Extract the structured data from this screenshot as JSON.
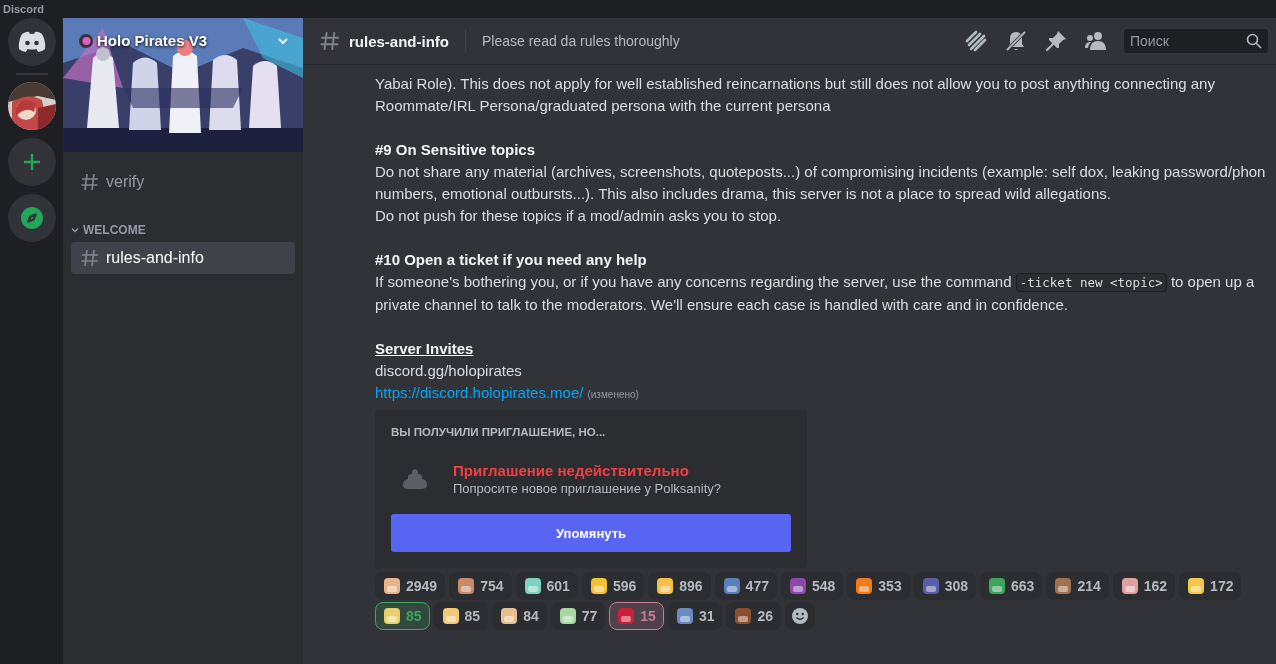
{
  "app_title": "Discord",
  "servers": [
    {
      "kind": "home"
    },
    {
      "kind": "server"
    },
    {
      "kind": "add"
    },
    {
      "kind": "discover"
    }
  ],
  "server": {
    "name": "Holo Pirates V3"
  },
  "channels": [
    {
      "name": "verify",
      "selected": false
    }
  ],
  "categories": [
    {
      "name": "WELCOME",
      "expanded": true,
      "channels": [
        {
          "name": "rules-and-info",
          "selected": true
        }
      ]
    }
  ],
  "header": {
    "channel": "rules-and-info",
    "topic": "Please read da rules thoroughly",
    "search": {
      "placeholder": "Поиск"
    }
  },
  "message": [
    {
      "kind": "text",
      "text": "Yabai Role). This does not apply for well established reincarnations but still does not allow you to post anything connecting any Roommate/IRL Persona/graduated persona with the current persona"
    },
    {
      "kind": "heading",
      "text": "#9 On Sensitive topics"
    },
    {
      "kind": "text",
      "text": "Do not share any material (archives, screenshots, quoteposts...) of compromising incidents (example: self dox, leaking password/phon numbers, emotional outbursts...). This also includes drama, this server is not a place to spread wild allegations."
    },
    {
      "kind": "text",
      "text": "Do not push for these topics if a mod/admin asks you to stop."
    },
    {
      "kind": "heading",
      "text": "#10 Open a ticket if you need any help"
    },
    {
      "kind": "mixed",
      "parts": [
        {
          "kind": "text",
          "text": "If someone's bothering you, or if you have any concerns regarding the server, use the command "
        },
        {
          "kind": "code",
          "text": "-ticket new <topic>"
        },
        {
          "kind": "text",
          "text": " to open up a private channel to talk to the moderators. We'll ensure each case is handled with care and in confidence."
        }
      ]
    },
    {
      "kind": "title",
      "text": "Server Invites"
    },
    {
      "kind": "text",
      "text": "discord.gg/holopirates"
    },
    {
      "kind": "link",
      "text": "https://discord.holopirates.moe/",
      "note": "(изменено)"
    }
  ],
  "invite": {
    "title": "ВЫ ПОЛУЧИЛИ ПРИГЛАШЕНИЕ, НО...",
    "status": "Приглашение недействительно",
    "hint": "Попросите новое приглашение у Polksanity?",
    "button": "Упомянуть"
  },
  "reaction_rows": [
    [
      {
        "count": "2949",
        "selected": false
      },
      {
        "count": "754",
        "selected": false
      },
      {
        "count": "601",
        "selected": false
      },
      {
        "count": "596",
        "selected": false
      },
      {
        "count": "896",
        "selected": false
      },
      {
        "count": "477",
        "selected": false
      },
      {
        "count": "548",
        "selected": false
      },
      {
        "count": "353",
        "selected": false
      },
      {
        "count": "308",
        "selected": false
      },
      {
        "count": "663",
        "selected": false
      },
      {
        "count": "214",
        "selected": false
      },
      {
        "count": "162",
        "selected": false
      },
      {
        "count": "172",
        "selected": false
      }
    ],
    [
      {
        "count": "85",
        "selected": true,
        "color": "#3ba55c"
      },
      {
        "count": "85",
        "selected": false
      },
      {
        "count": "84",
        "selected": false
      },
      {
        "count": "77",
        "selected": false
      },
      {
        "count": "15",
        "selected": true,
        "color": "#c27c93"
      },
      {
        "count": "31",
        "selected": false
      },
      {
        "count": "26",
        "selected": false
      }
    ]
  ]
}
